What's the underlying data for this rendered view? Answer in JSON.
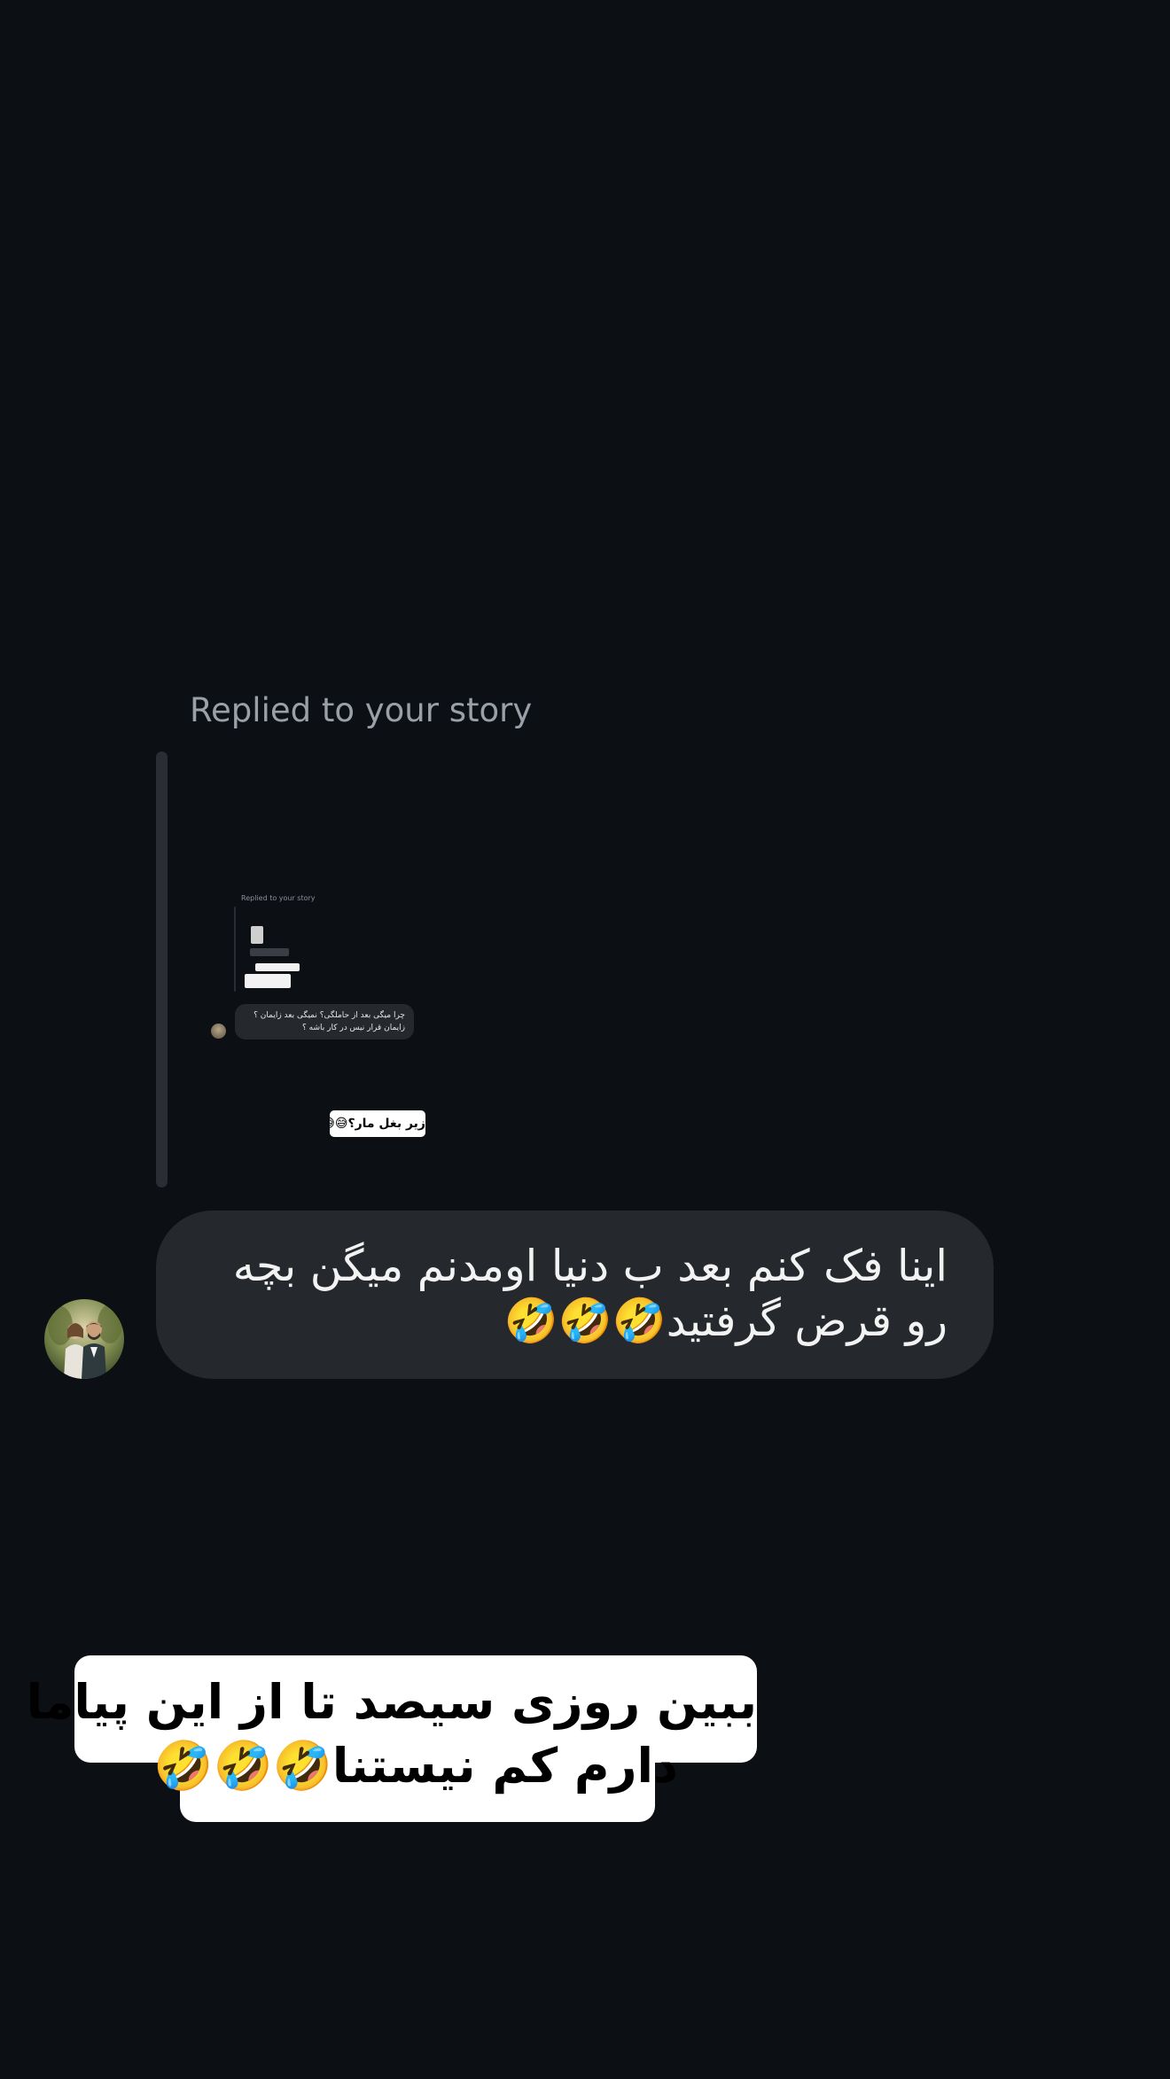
{
  "reply_context": {
    "label": "Replied to your story",
    "preview": {
      "replied_label": "Replied to your story",
      "bubble_text": "چرا میگی بعد از حاملگی؟ نمیگی بعد زایمان ؟ زایمان قرار نیس در کار باشه ؟",
      "sticker_text": "زیر بغل مار؟😅😅"
    }
  },
  "message": {
    "text": "اینا فک کنم بعد ب دنیا اومدنم میگن بچه رو قرض گرفتید🤣🤣🤣",
    "sender_avatar": "avatar"
  },
  "caption": {
    "line1": "ببین روزی سیصد تا از این پیاما",
    "line2": "دارم کم نیستنا🤣🤣🤣"
  }
}
